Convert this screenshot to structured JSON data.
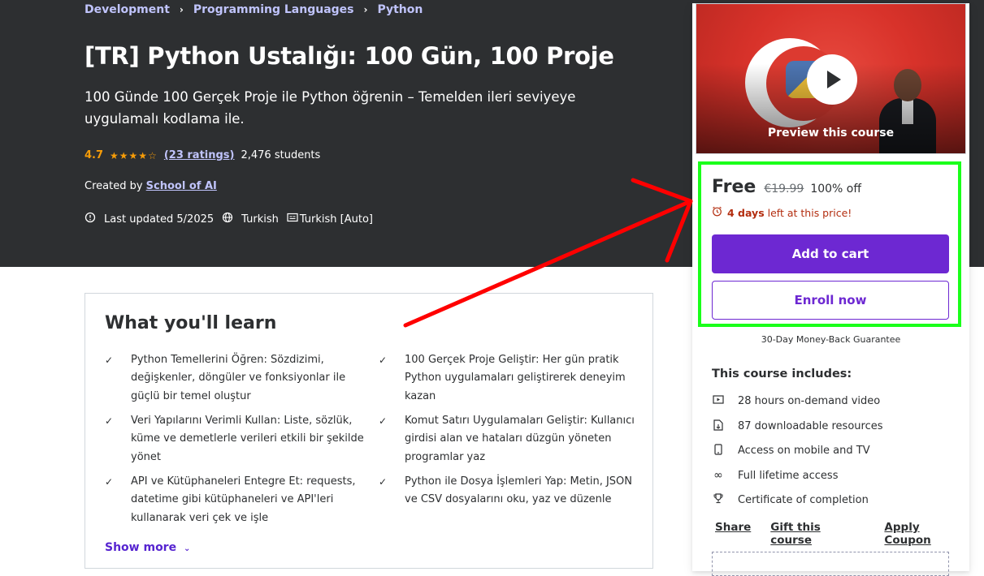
{
  "breadcrumb": {
    "items": [
      "Development",
      "Programming Languages",
      "Python"
    ],
    "separator": "›"
  },
  "course": {
    "title": "[TR] Python Ustalığı: 100 Gün, 100 Proje",
    "subtitle": "100 Günde 100 Gerçek Proje ile Python öğrenin – Temelden ileri seviyeye uygulamalı kodlama ile.",
    "rating": "4.7",
    "stars": "★★★★☆",
    "ratings_count": "(23 ratings)",
    "students": "2,476 students",
    "created_by_label": "Created by",
    "author": "School of AI",
    "last_updated": "Last updated 5/2025",
    "language": "Turkish",
    "captions": "Turkish [Auto]"
  },
  "learn": {
    "title": "What you'll learn",
    "items": [
      "Python Temellerini Öğren: Sözdizimi, değişkenler, döngüler ve fonksiyonlar ile güçlü bir temel oluştur",
      "100 Gerçek Proje Geliştir: Her gün pratik Python uygulamaları geliştirerek deneyim kazan",
      "Veri Yapılarını Verimli Kullan: Liste, sözlük, küme ve demetlerle verileri etkili bir şekilde yönet",
      "Komut Satırı Uygulamaları Geliştir: Kullanıcı girdisi alan ve hataları düzgün yöneten programlar yaz",
      "API ve Kütüphaneleri Entegre Et: requests, datetime gibi kütüphaneleri ve API'leri kullanarak veri çek ve işle",
      "Python ile Dosya İşlemleri Yap: Metin, JSON ve CSV dosyalarını oku, yaz ve düzenle"
    ],
    "show_more": "Show more"
  },
  "sidebar": {
    "preview_label": "Preview this course",
    "price": "Free",
    "original_price": "€19.99",
    "discount": "100% off",
    "timer_days": "4 days",
    "timer_text": "left at this price!",
    "add_to_cart": "Add to cart",
    "enroll_now": "Enroll now",
    "guarantee": "30-Day Money-Back Guarantee",
    "includes_title": "This course includes:",
    "includes": [
      {
        "icon": "video-icon",
        "text": "28 hours on-demand video"
      },
      {
        "icon": "file-download-icon",
        "text": "87 downloadable resources"
      },
      {
        "icon": "mobile-icon",
        "text": "Access on mobile and TV"
      },
      {
        "icon": "infinity-icon",
        "text": "Full lifetime access"
      },
      {
        "icon": "trophy-icon",
        "text": "Certificate of completion"
      }
    ],
    "links": {
      "share": "Share",
      "gift": "Gift this course",
      "coupon": "Apply Coupon"
    }
  },
  "colors": {
    "hero_bg": "#2d2f31",
    "link_purple_light": "#c0c4fc",
    "accent_purple": "#6d28d2",
    "rating_orange": "#f69c08",
    "timer_red": "#b32d0f",
    "annotation_green": "#1aff1a",
    "annotation_red": "#ff0000"
  }
}
